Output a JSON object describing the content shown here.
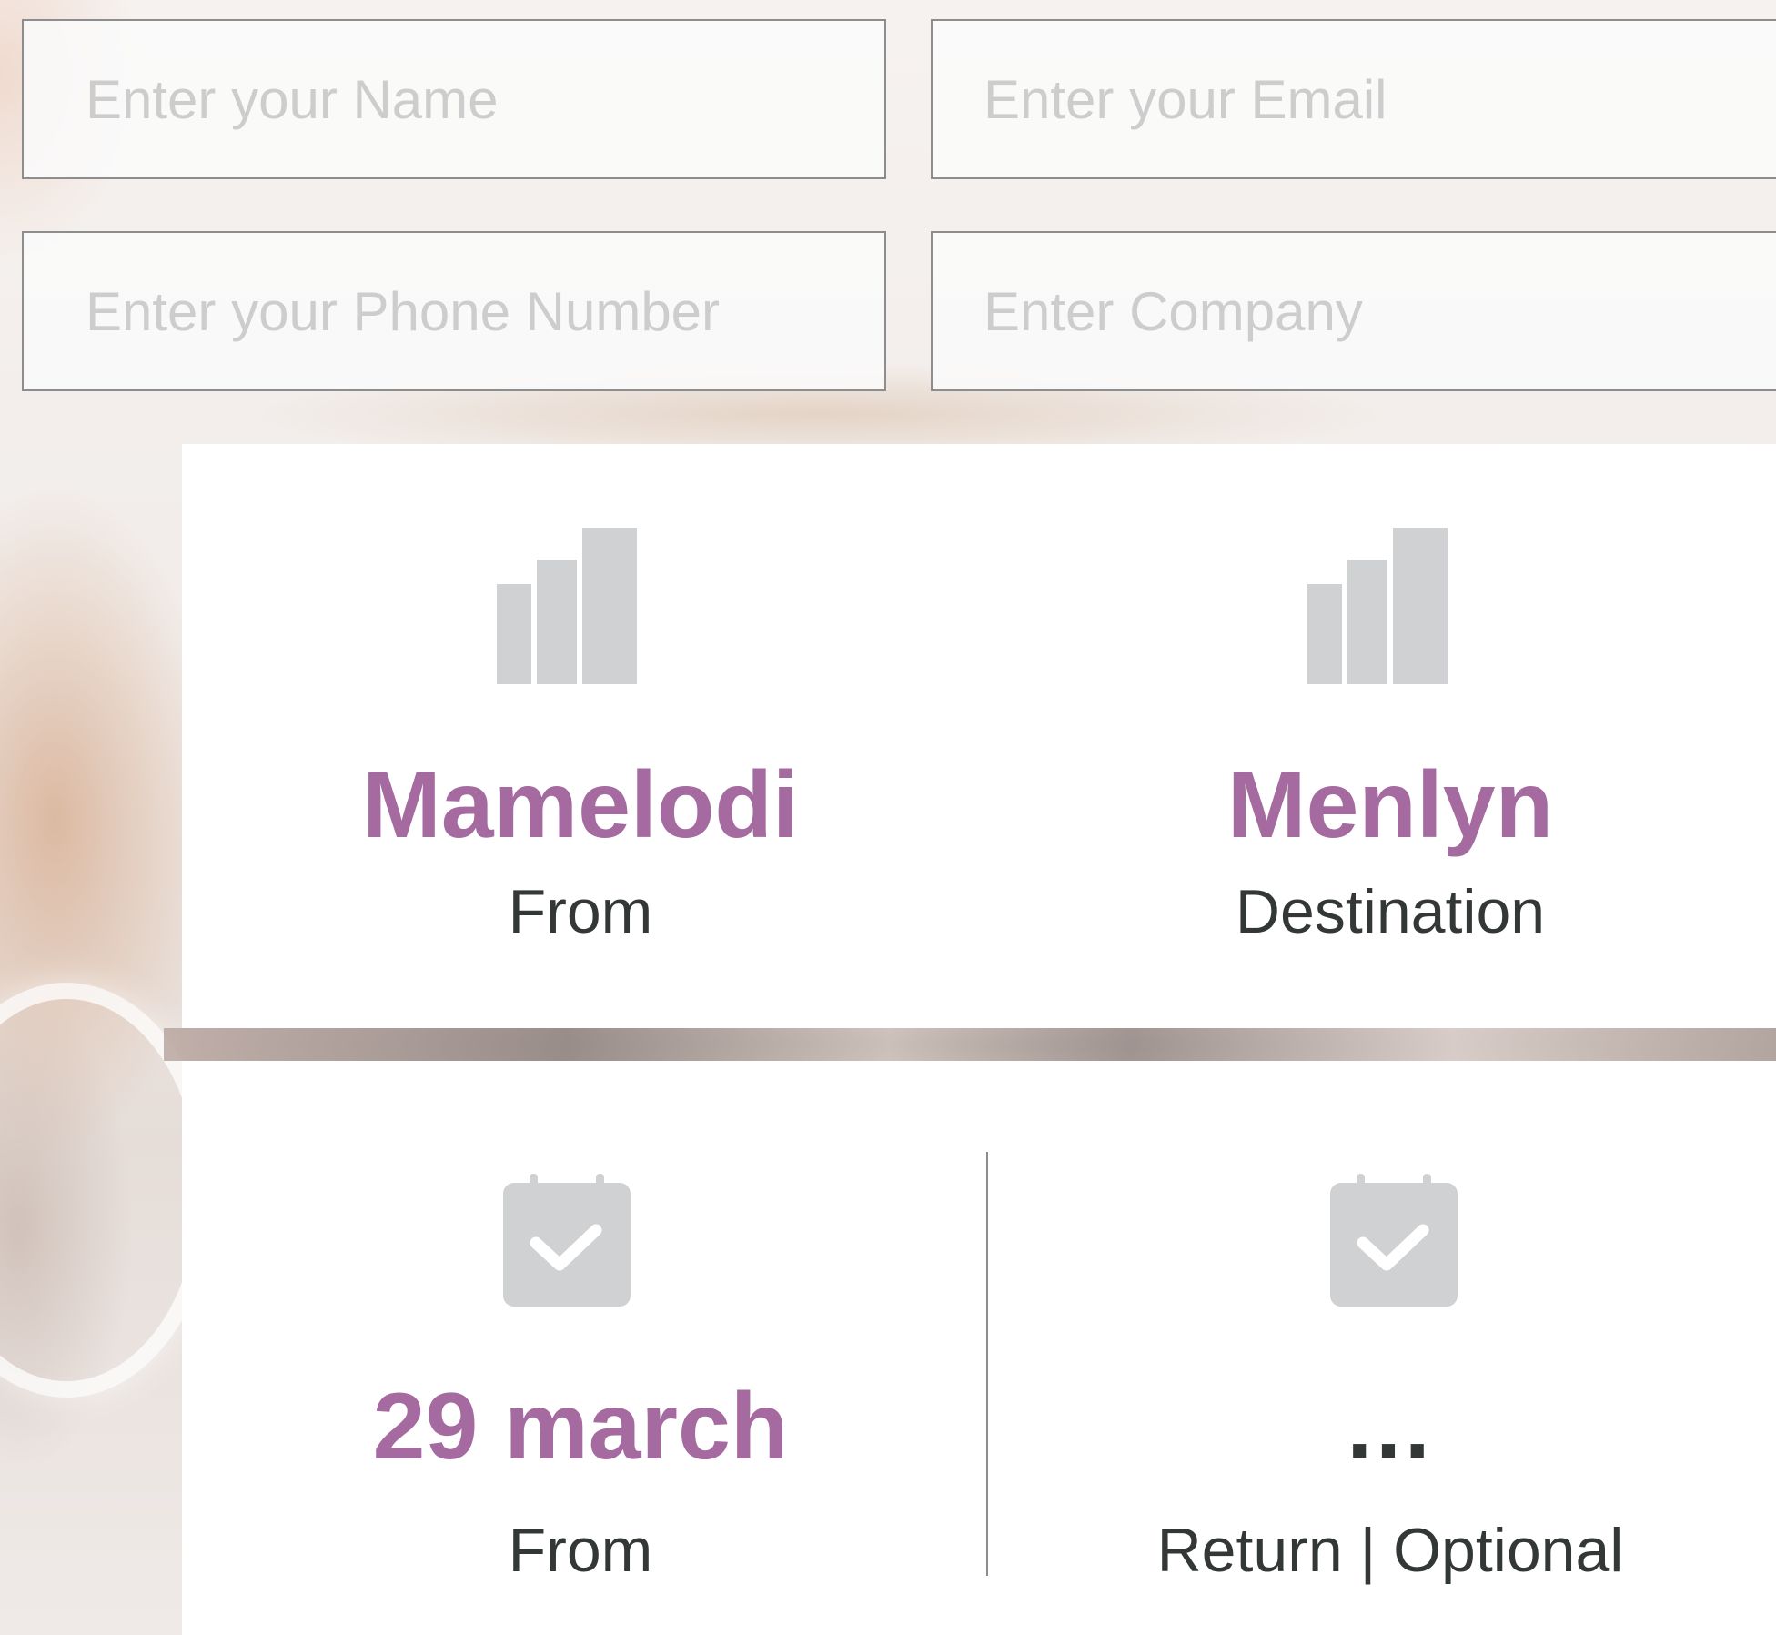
{
  "form": {
    "name_placeholder": "Enter your Name",
    "email_placeholder": "Enter your Email",
    "phone_placeholder": "Enter your Phone Number",
    "company_placeholder": "Enter Company"
  },
  "route": {
    "from": {
      "value": "Mamelodi",
      "label": "From",
      "icon": "bar-chart-icon"
    },
    "to": {
      "value": "Menlyn",
      "label": "Destination",
      "icon": "bar-chart-icon"
    }
  },
  "dates": {
    "depart": {
      "value": "29 march",
      "label": "From",
      "icon": "calendar-check-icon"
    },
    "return": {
      "value": "...",
      "label": "Return | Optional",
      "icon": "calendar-check-icon"
    }
  },
  "colors": {
    "accent": "#a56aa0",
    "text": "#333836",
    "icon": "#d0d1d3",
    "placeholder": "#cdcdcd",
    "field_border": "#8d8d8d"
  }
}
